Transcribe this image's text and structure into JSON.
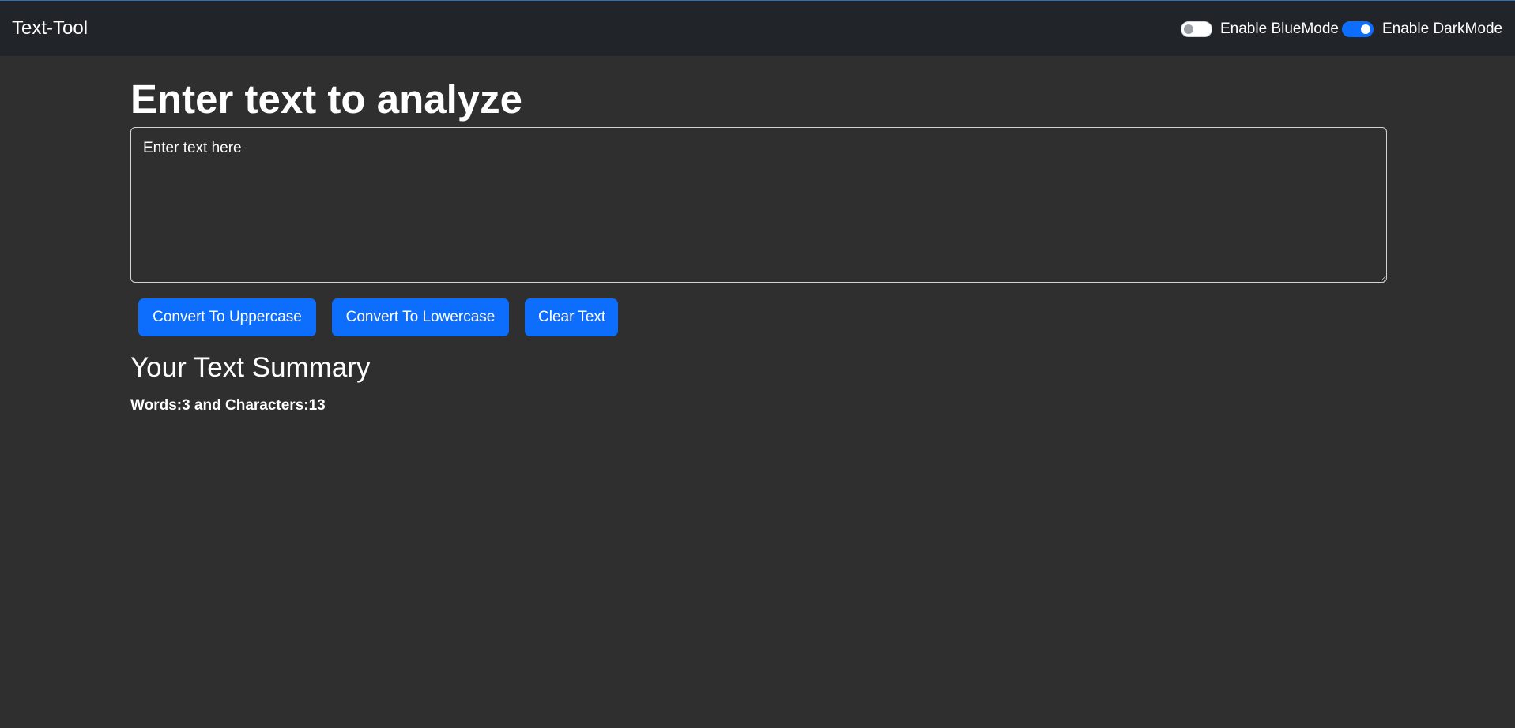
{
  "navbar": {
    "brand": "Text-Tool",
    "blue_mode": {
      "label": "Enable BlueMode",
      "enabled": false
    },
    "dark_mode": {
      "label": "Enable DarkMode",
      "enabled": true
    }
  },
  "main": {
    "heading": "Enter text to analyze",
    "textarea": {
      "value": "",
      "placeholder": "Enter text here"
    },
    "buttons": {
      "uppercase": "Convert To Uppercase",
      "lowercase": "Convert To Lowercase",
      "clear": "Clear Text"
    },
    "summary": {
      "heading": "Your Text Summary",
      "stats": "Words:3 and Characters:13"
    }
  },
  "colors": {
    "navbar_bg": "#212529",
    "page_bg": "#2f2f2f",
    "accent": "#0d6efd",
    "text": "#ffffff"
  }
}
